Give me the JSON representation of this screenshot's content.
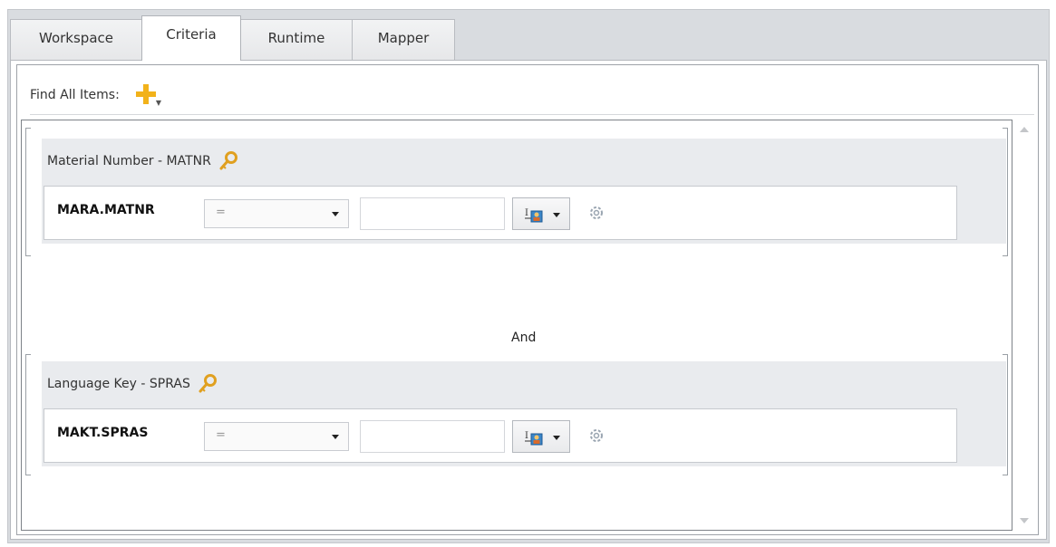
{
  "tabs": [
    {
      "label": "Workspace",
      "active": false
    },
    {
      "label": "Criteria",
      "active": true
    },
    {
      "label": "Runtime",
      "active": false
    },
    {
      "label": "Mapper",
      "active": false
    }
  ],
  "criteria": {
    "find_label": "Find All Items:",
    "add_icon": "add-plus-icon",
    "groups": [
      {
        "title": "Material Number - MATNR",
        "key_icon": "key-icon",
        "field": "MARA.MATNR",
        "operator": "=",
        "value": "",
        "value_type_icon": "value-type-icon",
        "options_icon": "gear-icon"
      },
      {
        "title": "Language Key - SPRAS",
        "key_icon": "key-icon",
        "field": "MAKT.SPRAS",
        "operator": "=",
        "value": "",
        "value_type_icon": "value-type-icon",
        "options_icon": "gear-icon"
      }
    ],
    "joiner": "And"
  },
  "colors": {
    "accent_plus": "#f2b21a",
    "key": "#e0a020",
    "group_background": "#e9ebee"
  }
}
